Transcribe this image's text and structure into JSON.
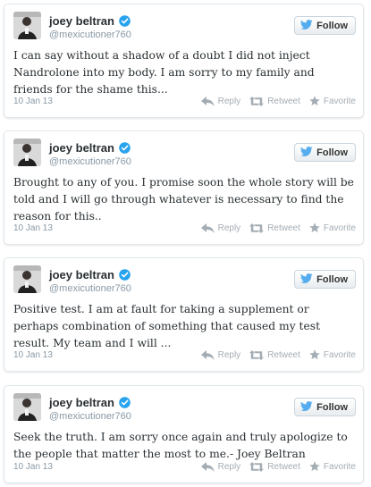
{
  "tweets": [
    {
      "name": "joey beltran",
      "handle": "@mexicutioner760",
      "follow_label": "Follow",
      "text": "I can say without a shadow of a doubt I did not inject Nandrolone into my body. I am sorry to my family and friends for the shame this...",
      "date": "10 Jan 13",
      "reply_label": "Reply",
      "retweet_label": "Retweet",
      "favorite_label": "Favorite"
    },
    {
      "name": "joey beltran",
      "handle": "@mexicutioner760",
      "follow_label": "Follow",
      "text": "Brought to any of you. I promise soon the whole story will be told and I will go through whatever is necessary to find the reason for this..",
      "date": "10 Jan 13",
      "reply_label": "Reply",
      "retweet_label": "Retweet",
      "favorite_label": "Favorite"
    },
    {
      "name": "joey beltran",
      "handle": "@mexicutioner760",
      "follow_label": "Follow",
      "text": "Positive test. I am at fault for taking a supplement or perhaps combination of something that caused my test result. My team and I will ...",
      "date": "10 Jan 13",
      "reply_label": "Reply",
      "retweet_label": "Retweet",
      "favorite_label": "Favorite"
    },
    {
      "name": "joey beltran",
      "handle": "@mexicutioner760",
      "follow_label": "Follow",
      "text": "Seek the truth. I am sorry once again and truly apologize to the people that matter the most to me.- Joey Beltran",
      "date": "10 Jan 13",
      "reply_label": "Reply",
      "retweet_label": "Retweet",
      "favorite_label": "Favorite"
    }
  ],
  "icons": {
    "verified": "verified-badge-icon",
    "follow": "twitter-bird-icon",
    "reply": "reply-arrow-icon",
    "retweet": "retweet-icon",
    "favorite": "star-icon"
  },
  "colors": {
    "verified": "#2aa3ef",
    "bird": "#55acee",
    "action": "#a4adb4",
    "border": "#e1e8ed"
  }
}
